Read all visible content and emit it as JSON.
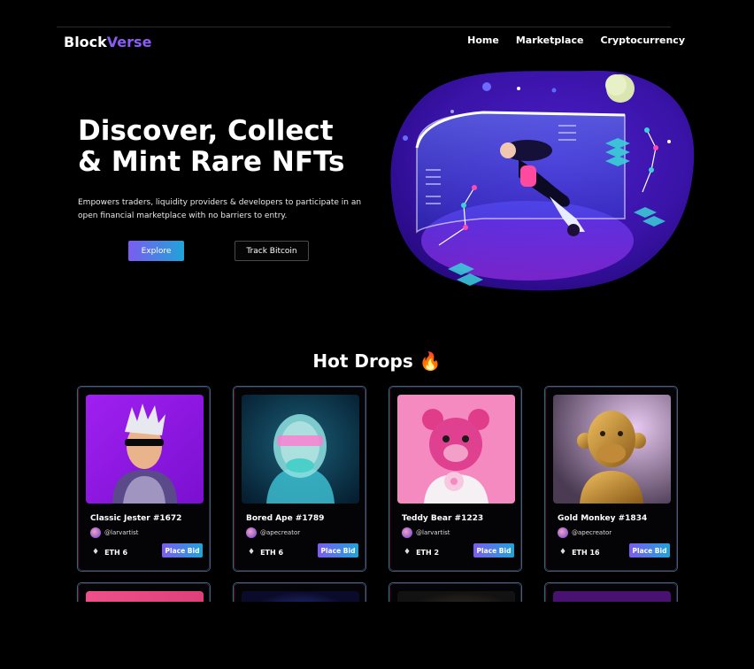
{
  "brand": {
    "part1": "Block",
    "part2": "Verse"
  },
  "nav": {
    "items": [
      "Home",
      "Marketplace",
      "Cryptocurrency"
    ]
  },
  "hero": {
    "title_line1": "Discover, Collect",
    "title_line2": "& Mint Rare NFTs",
    "description": "Empowers traders, liquidity providers & developers to participate in an open financial marketplace with no barriers to entry.",
    "explore_label": "Explore",
    "track_label": "Track Bitcoin"
  },
  "section": {
    "title": "Hot Drops",
    "emoji": "🔥"
  },
  "cards": [
    {
      "name": "Classic Jester #1672",
      "creator": "@larvartist",
      "price": "ETH 6",
      "bid": "Place Bid"
    },
    {
      "name": "Bored Ape #1789",
      "creator": "@apecreator",
      "price": "ETH 6",
      "bid": "Place Bid"
    },
    {
      "name": "Teddy Bear #1223",
      "creator": "@larvartist",
      "price": "ETH 2",
      "bid": "Place Bid"
    },
    {
      "name": "Gold Monkey #1834",
      "creator": "@apecreator",
      "price": "ETH 16",
      "bid": "Place Bid"
    }
  ],
  "colors": {
    "accent_purple": "#8b5cf6",
    "accent_cyan": "#1fa4d8",
    "background": "#000000",
    "card_border": "#1d6f82"
  },
  "icons": {
    "eth": "ethereum-icon",
    "fire": "fire-icon",
    "avatar": "avatar"
  }
}
